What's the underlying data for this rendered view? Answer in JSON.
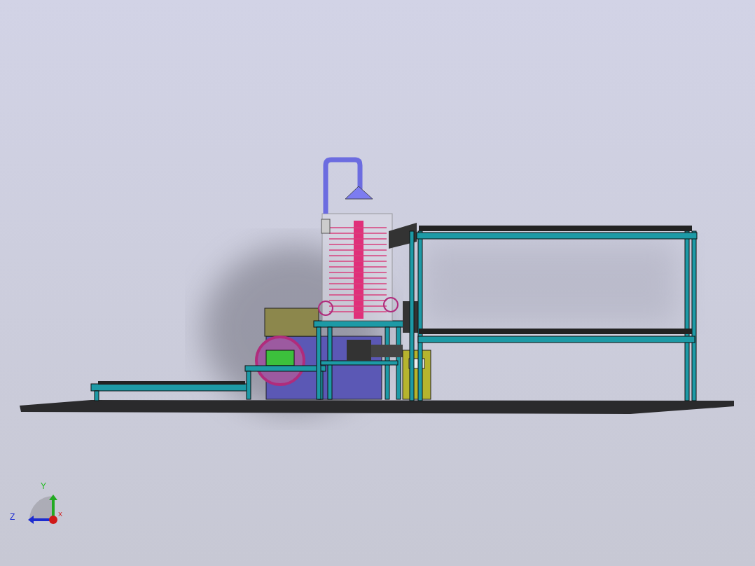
{
  "viewport": {
    "triad": {
      "axes": [
        {
          "label": "Y",
          "kind": "y"
        },
        {
          "label": "Z",
          "kind": "z"
        },
        {
          "label": "X",
          "kind": "x"
        }
      ]
    }
  }
}
